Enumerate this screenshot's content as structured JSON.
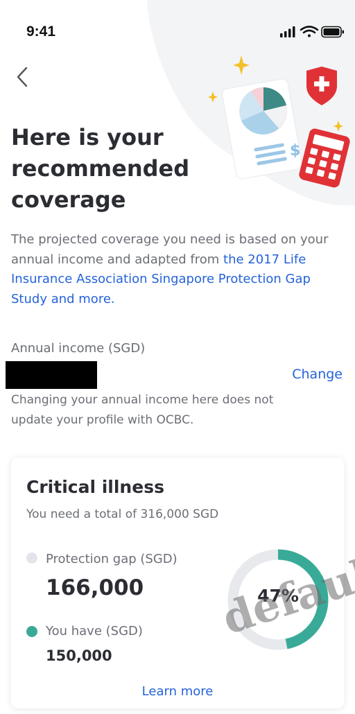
{
  "status_bar": {
    "time": "9:41"
  },
  "header": {
    "title_lines": [
      "Here is your",
      "recommended",
      "coverage"
    ]
  },
  "intro": {
    "text": "The projected coverage you need is based on your annual income and adapted from ",
    "link_text": "the 2017 Life Insurance Association Singapore Protection Gap Study and more."
  },
  "income": {
    "label": "Annual income (SGD)",
    "change_label": "Change",
    "note": "Changing your annual income here does not update your profile with OCBC."
  },
  "card": {
    "title": "Critical illness",
    "subtitle": "You need a total of 316,000 SGD",
    "gap_label": "Protection gap (SGD)",
    "gap_value": "166,000",
    "have_label": "You have (SGD)",
    "have_value": "150,000",
    "percent_label": "47%",
    "percent_fraction": 0.47,
    "learn_more": "Learn more"
  },
  "colors": {
    "accent_link": "#2563d9",
    "have_teal": "#3aaa98",
    "gap_gray": "#e3e5ea"
  },
  "icons": [
    "back-icon",
    "signal-icon",
    "wifi-icon",
    "battery-icon",
    "shield-icon",
    "pie-chart-icon",
    "calculator-icon",
    "sparkle-icon"
  ],
  "watermark": "default"
}
